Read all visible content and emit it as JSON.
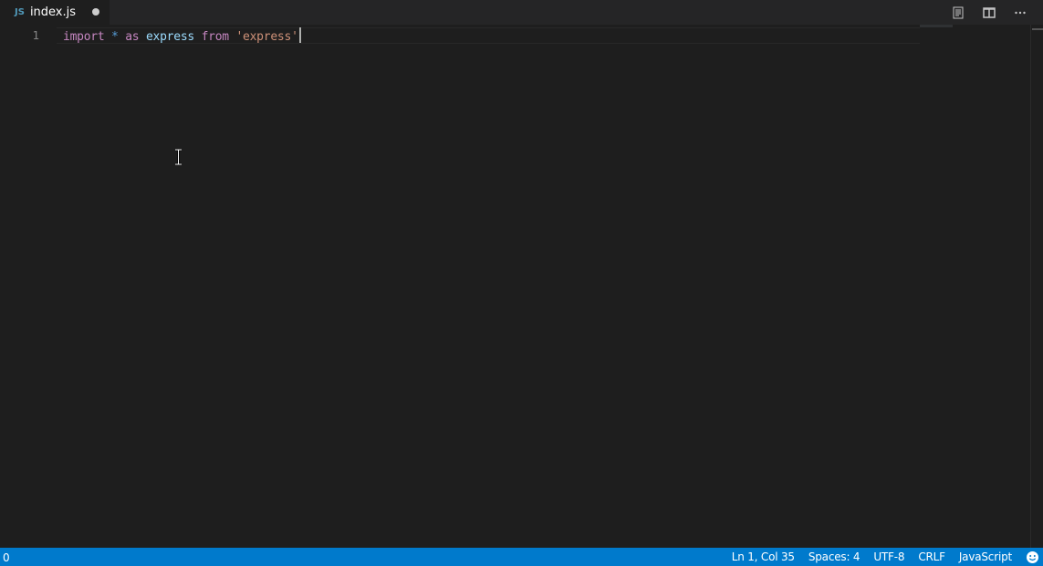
{
  "tabs": [
    {
      "icon": "js-file-icon",
      "icon_text": "JS",
      "label": "index.js",
      "dirty": true
    }
  ],
  "tab_actions": [
    {
      "name": "open-preview-icon"
    },
    {
      "name": "split-editor-icon"
    },
    {
      "name": "more-actions-icon",
      "text": "···"
    }
  ],
  "editor": {
    "line_number": "1",
    "tokens": {
      "import_kw": "import",
      "star": "*",
      "as_kw": "as",
      "ident": "express",
      "from_kw": "from",
      "string": "'express'"
    }
  },
  "status": {
    "left": "0",
    "position": "Ln 1, Col 35",
    "spaces": "Spaces: 4",
    "encoding": "UTF-8",
    "eol": "CRLF",
    "language": "JavaScript"
  },
  "colors": {
    "statusbar": "#007acc",
    "editor_bg": "#1e1e1e",
    "tabbar_bg": "#252526",
    "keyword": "#c586c0",
    "identifier": "#9cdcfe",
    "string": "#ce9178",
    "operator": "#569cd6"
  }
}
